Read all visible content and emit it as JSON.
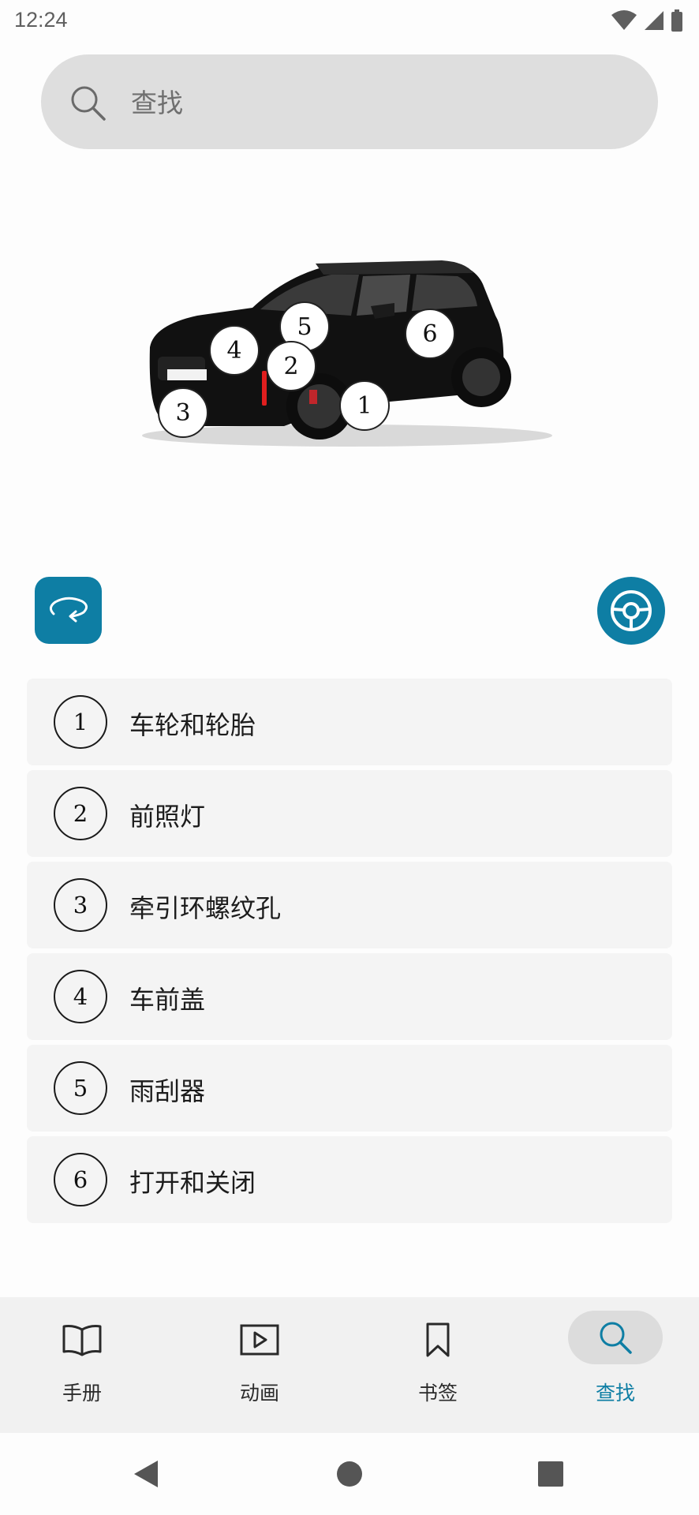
{
  "status": {
    "time": "12:24"
  },
  "search": {
    "placeholder": "查找"
  },
  "hotspots": [
    "5",
    "6",
    "4",
    "2",
    "3",
    "1"
  ],
  "components": [
    {
      "number": "1",
      "label": "车轮和轮胎"
    },
    {
      "number": "2",
      "label": "前照灯"
    },
    {
      "number": "3",
      "label": "牵引环螺纹孔"
    },
    {
      "number": "4",
      "label": "车前盖"
    },
    {
      "number": "5",
      "label": "雨刮器"
    },
    {
      "number": "6",
      "label": "打开和关闭"
    }
  ],
  "nav": {
    "manual": "手册",
    "animation": "动画",
    "bookmarks": "书签",
    "search": "查找"
  },
  "colors": {
    "accent": "#0e7ea4"
  }
}
